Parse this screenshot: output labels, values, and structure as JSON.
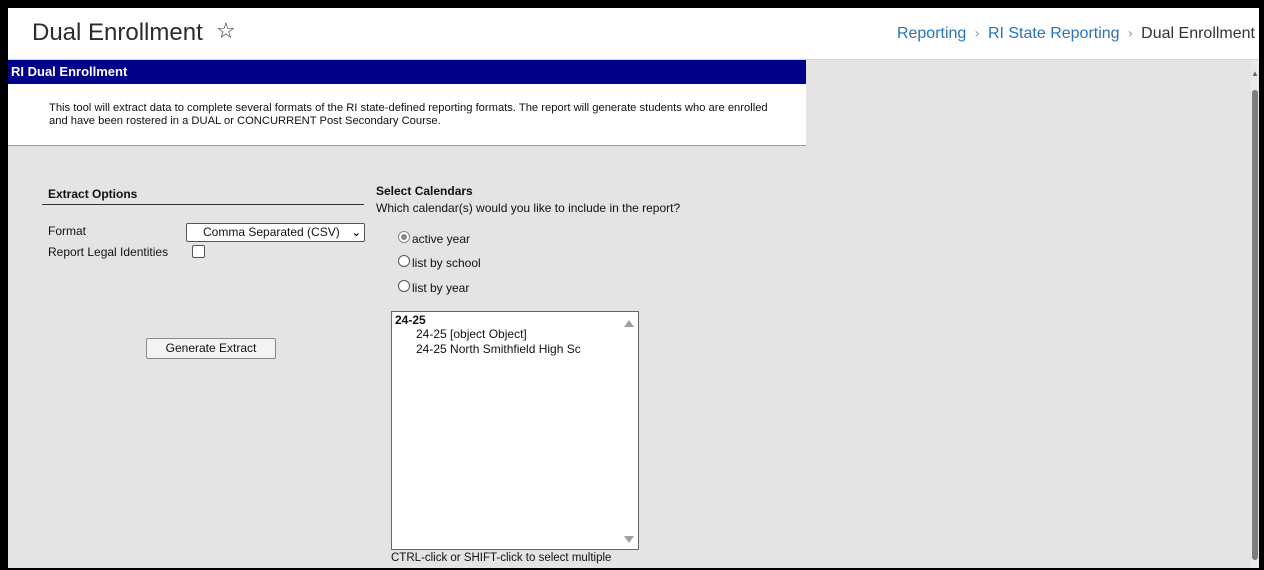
{
  "header": {
    "title": "Dual Enrollment",
    "breadcrumb": [
      "Reporting",
      "RI State Reporting",
      "Dual Enrollment"
    ]
  },
  "section": {
    "title": "RI Dual Enrollment",
    "description": "This tool will extract data to complete several formats of the RI state-defined reporting formats. The report will generate students who are enrolled and have been rostered in a DUAL or CONCURRENT Post Secondary Course."
  },
  "extract_options": {
    "title": "Extract Options",
    "format_label": "Format",
    "format_value": "Comma Separated (CSV)",
    "legal_identities_label": "Report Legal Identities",
    "legal_identities_checked": false,
    "generate_label": "Generate Extract"
  },
  "calendars": {
    "title": "Select Calendars",
    "question": "Which calendar(s) would you like to include in the report?",
    "options": [
      {
        "label": "active year",
        "checked": true
      },
      {
        "label": "list by school",
        "checked": false
      },
      {
        "label": "list by year",
        "checked": false
      }
    ],
    "list_group": "24-25",
    "list_items": [
      "24-25 [object Object]",
      "24-25 North Smithfield High Sc"
    ],
    "hint": "CTRL-click or SHIFT-click to select multiple"
  },
  "colors": {
    "section_bar": "#00008b",
    "link": "#2a74b5",
    "panel_bg": "#e4e4e4"
  }
}
